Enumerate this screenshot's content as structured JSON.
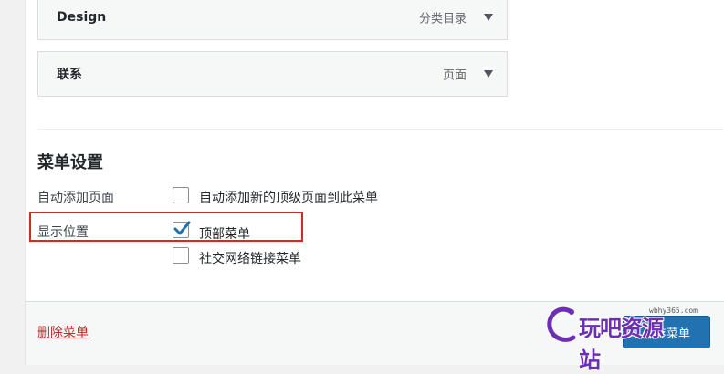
{
  "menu_items": [
    {
      "title": "Design",
      "type": "分类目录"
    },
    {
      "title": "联系",
      "type": "页面"
    }
  ],
  "settings": {
    "title": "菜单设置",
    "auto_add": {
      "label": "自动添加页面",
      "option": {
        "label": "自动添加新的顶级页面到此菜单",
        "checked": false
      }
    },
    "display_location": {
      "label": "显示位置",
      "options": [
        {
          "label": "顶部菜单",
          "checked": true
        },
        {
          "label": "社交网络链接菜单",
          "checked": false
        }
      ]
    }
  },
  "footer": {
    "delete_label": "删除菜单",
    "save_label": "保存菜单"
  },
  "watermark": {
    "domain": "wbhy365.com",
    "text": "玩吧资源站"
  },
  "colors": {
    "accent": "#2271b1",
    "delete": "#b32d2e",
    "highlight": "#e02424",
    "watermark": "#6b2fb3"
  },
  "icons": {
    "toggle": "triangle-down-icon",
    "check": "checkmark-icon"
  }
}
